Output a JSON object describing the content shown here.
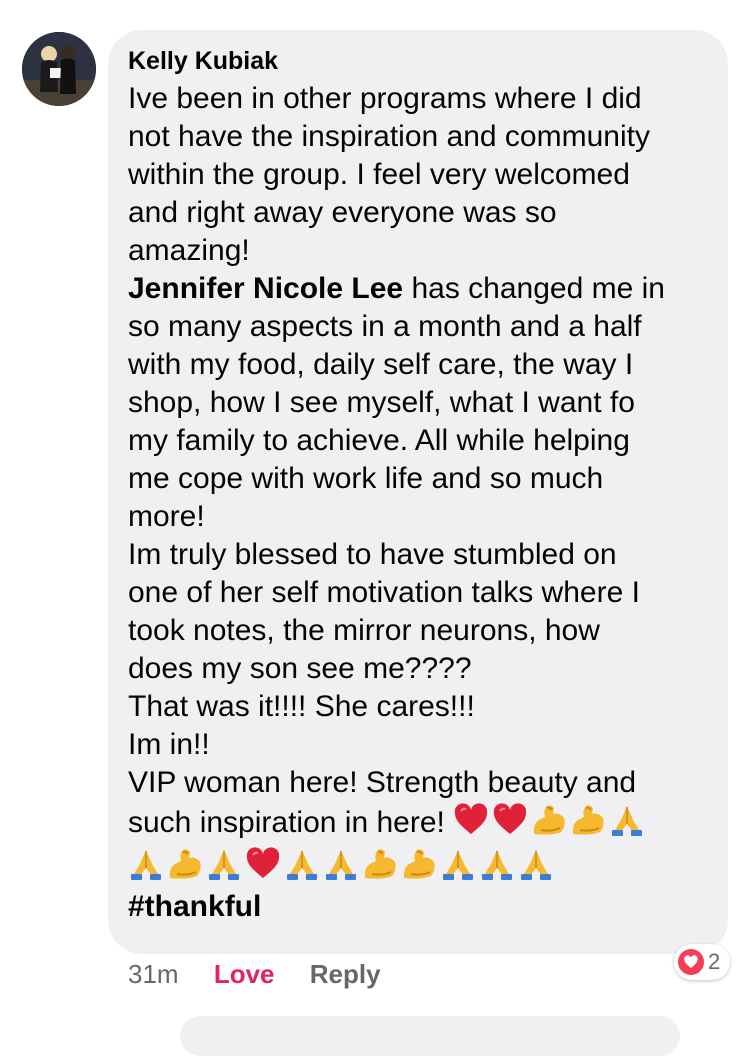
{
  "comment": {
    "author": "Kelly Kubiak",
    "lines": [
      "Ive been in other programs where I did",
      "not have the inspiration and community",
      "within the group. I feel very welcomed",
      "and right away everyone was so",
      "amazing!",
      "has changed me in",
      "so many aspects in a month and a half",
      "with my food, daily self care, the way I",
      "shop, how I see myself, what I want fo",
      "my family to achieve. All while helping",
      "me cope with work life and so much",
      "more!",
      "Im truly blessed to have stumbled on",
      "one of her self motivation talks where I",
      "took notes, the mirror neurons, how",
      "does my son see me????",
      "That was it!!!! She cares!!!",
      "Im in!!",
      "VIP woman here! Strength beauty and",
      "such inspiration in here!"
    ],
    "mention": "Jennifer Nicole Lee",
    "emoji_row1": [
      "red-heart",
      "red-heart",
      "flexed-biceps",
      "flexed-biceps",
      "folded-hands"
    ],
    "emoji_row2": [
      "folded-hands",
      "flexed-biceps",
      "folded-hands",
      "red-heart",
      "folded-hands",
      "folded-hands",
      "flexed-biceps",
      "flexed-biceps",
      "folded-hands",
      "folded-hands",
      "folded-hands"
    ],
    "hashtag": "#thankful"
  },
  "footer": {
    "time": "31m",
    "love_label": "Love",
    "reply_label": "Reply"
  },
  "reaction": {
    "icon": "heart-icon",
    "count": "2"
  },
  "colors": {
    "bubble": "#f0f0f3",
    "love": "#e0245e",
    "meta": "#65676b",
    "heart": "#f33e58"
  }
}
